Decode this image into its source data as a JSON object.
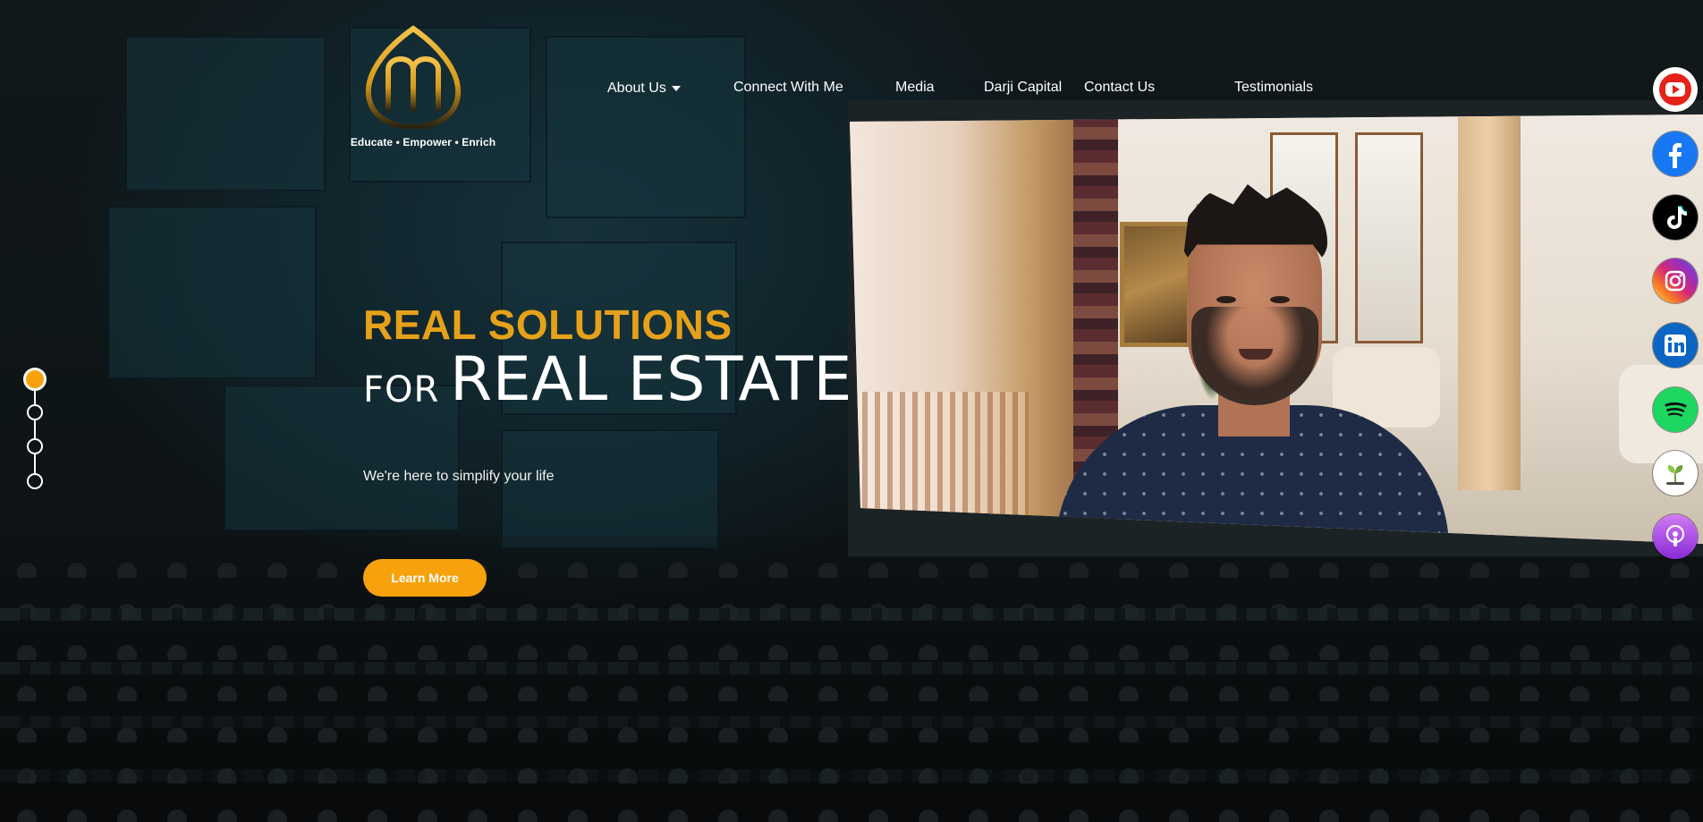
{
  "logo": {
    "tagline": "Educate • Empower • Enrich",
    "monogram_color": "#e6a11a"
  },
  "nav": {
    "items": [
      {
        "label": "About Us",
        "has_dropdown": true
      },
      {
        "label": "Connect With Me",
        "has_dropdown": false
      },
      {
        "label": "Media",
        "has_dropdown": false
      },
      {
        "label": "Darji Capital",
        "has_dropdown": false
      },
      {
        "label": "Contact Us",
        "has_dropdown": false
      },
      {
        "label": "Testimonials",
        "has_dropdown": false
      }
    ]
  },
  "hero": {
    "headline_accent": "REAL SOLUTIONS",
    "headline_for": "FOR",
    "headline_main": "REAL ESTATE",
    "subtext": "We're here to simplify your life",
    "cta_label": "Learn More",
    "accent_color": "#e6a11a",
    "button_color": "#f7a20c"
  },
  "slider": {
    "total_slides": 4,
    "active_index": 0
  },
  "social": [
    {
      "icon": "youtube-icon",
      "color": "#e62117"
    },
    {
      "icon": "facebook-icon",
      "color": "#1877f2"
    },
    {
      "icon": "tiktok-icon",
      "color": "#010101"
    },
    {
      "icon": "instagram-icon",
      "color": "#d6249f"
    },
    {
      "icon": "linkedin-icon",
      "color": "#0a66c2"
    },
    {
      "icon": "spotify-icon",
      "color": "#1ed760"
    },
    {
      "icon": "buzzsprout-icon",
      "color": "#ffffff"
    },
    {
      "icon": "apple-podcasts-icon",
      "color": "#9933cc"
    }
  ]
}
